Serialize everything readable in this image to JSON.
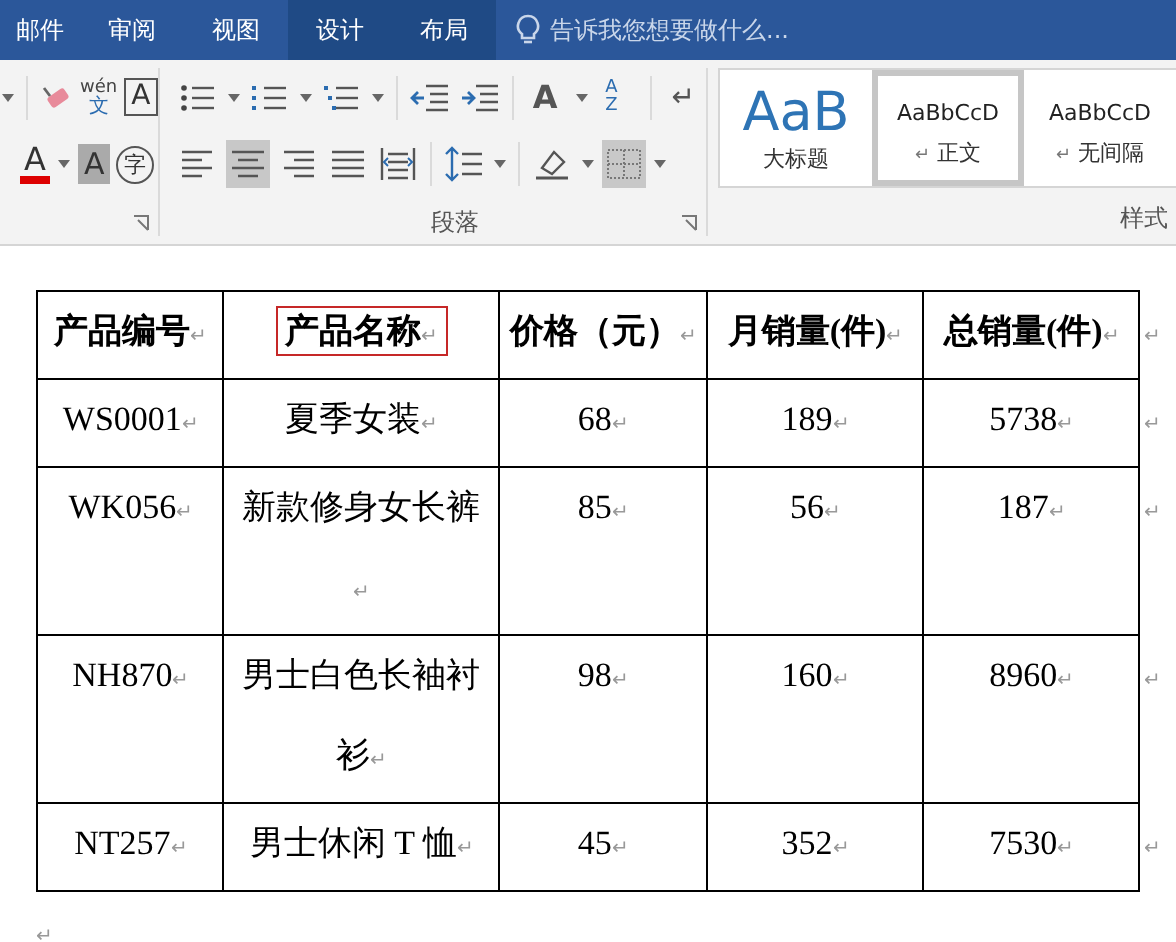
{
  "tabs": [
    {
      "label": "邮件",
      "contextual": false
    },
    {
      "label": "审阅",
      "contextual": false
    },
    {
      "label": "视图",
      "contextual": false
    },
    {
      "label": "设计",
      "contextual": true
    },
    {
      "label": "布局",
      "contextual": true
    }
  ],
  "tell_me": {
    "placeholder": "告诉我您想要做什么..."
  },
  "font_group": {
    "row1": [
      {
        "kind": "eraser"
      },
      {
        "kind": "phonetic",
        "top": "wén",
        "bottom": "文"
      },
      {
        "kind": "boxed",
        "label": "A"
      }
    ],
    "row2": [
      {
        "kind": "font-color",
        "label": "A"
      },
      {
        "kind": "shaded",
        "label": "A"
      },
      {
        "kind": "circled",
        "label": "字"
      }
    ]
  },
  "paragraph_group": {
    "label": "段落",
    "row1": [
      {
        "kind": "bullets",
        "selected": false
      },
      {
        "kind": "numbering",
        "selected": false
      },
      {
        "kind": "multilevel",
        "selected": false
      },
      {
        "kind": "outdent",
        "selected": false
      },
      {
        "kind": "indent",
        "selected": false
      },
      {
        "kind": "asian-layout",
        "label": "A",
        "selected": false
      },
      {
        "kind": "sort",
        "label": "AZ",
        "selected": false
      },
      {
        "kind": "marks",
        "label": "↵",
        "selected": false
      }
    ],
    "row2": [
      {
        "kind": "align-left",
        "selected": false
      },
      {
        "kind": "align-center",
        "selected": true
      },
      {
        "kind": "align-right",
        "selected": false
      },
      {
        "kind": "justify",
        "selected": false
      },
      {
        "kind": "distribute",
        "selected": false
      },
      {
        "kind": "line-spacing",
        "selected": false
      },
      {
        "kind": "shading",
        "selected": false
      },
      {
        "kind": "borders",
        "selected": true
      }
    ]
  },
  "styles_group": {
    "label": "样式",
    "styles": [
      {
        "kind": "title",
        "preview": "AaB",
        "name": "大标题",
        "selected": false
      },
      {
        "kind": "normal",
        "preview": "AaBbCcD",
        "name": "正文",
        "mark": "↵",
        "selected": true
      },
      {
        "kind": "normal",
        "preview": "AaBbCcD",
        "name": "无间隔",
        "mark": "↵",
        "selected": false
      }
    ]
  },
  "table": {
    "columns": [
      {
        "label": "产品编号",
        "mark": "↵",
        "highlighted": false
      },
      {
        "label": "产品名称",
        "mark": "↵",
        "highlighted": true
      },
      {
        "label": "价格（元）",
        "mark": "↵",
        "highlighted": false
      },
      {
        "label": "月销量(件)",
        "mark": "↵",
        "highlighted": false
      },
      {
        "label": "总销量(件)",
        "mark": "↵",
        "highlighted": false
      }
    ],
    "header_end_mark": "↵",
    "rows": [
      {
        "cells": [
          {
            "text": "WS0001",
            "mark": "↵"
          },
          {
            "text": "夏季女装",
            "mark": "↵"
          },
          {
            "text": "68",
            "mark": "↵"
          },
          {
            "text": "189",
            "mark": "↵"
          },
          {
            "text": "5738",
            "mark": "↵"
          }
        ],
        "end_mark": "↵"
      },
      {
        "cells": [
          {
            "text": "WK056",
            "mark": "↵"
          },
          {
            "text": "新款修身女长裤",
            "mark": "↵"
          },
          {
            "text": "85",
            "mark": "↵"
          },
          {
            "text": "56",
            "mark": "↵"
          },
          {
            "text": "187",
            "mark": "↵"
          }
        ],
        "end_mark": "↵"
      },
      {
        "cells": [
          {
            "text": "NH870",
            "mark": "↵"
          },
          {
            "text": "男士白色长袖衬衫",
            "mark": "↵"
          },
          {
            "text": "98",
            "mark": "↵"
          },
          {
            "text": "160",
            "mark": "↵"
          },
          {
            "text": "8960",
            "mark": "↵"
          }
        ],
        "end_mark": "↵"
      },
      {
        "cells": [
          {
            "text": "NT257",
            "mark": "↵"
          },
          {
            "text": "男士休闲 T 恤",
            "mark": "↵"
          },
          {
            "text": "45",
            "mark": "↵"
          },
          {
            "text": "352",
            "mark": "↵"
          },
          {
            "text": "7530",
            "mark": "↵"
          }
        ],
        "end_mark": "↵"
      }
    ]
  },
  "after_table_mark": "↵"
}
